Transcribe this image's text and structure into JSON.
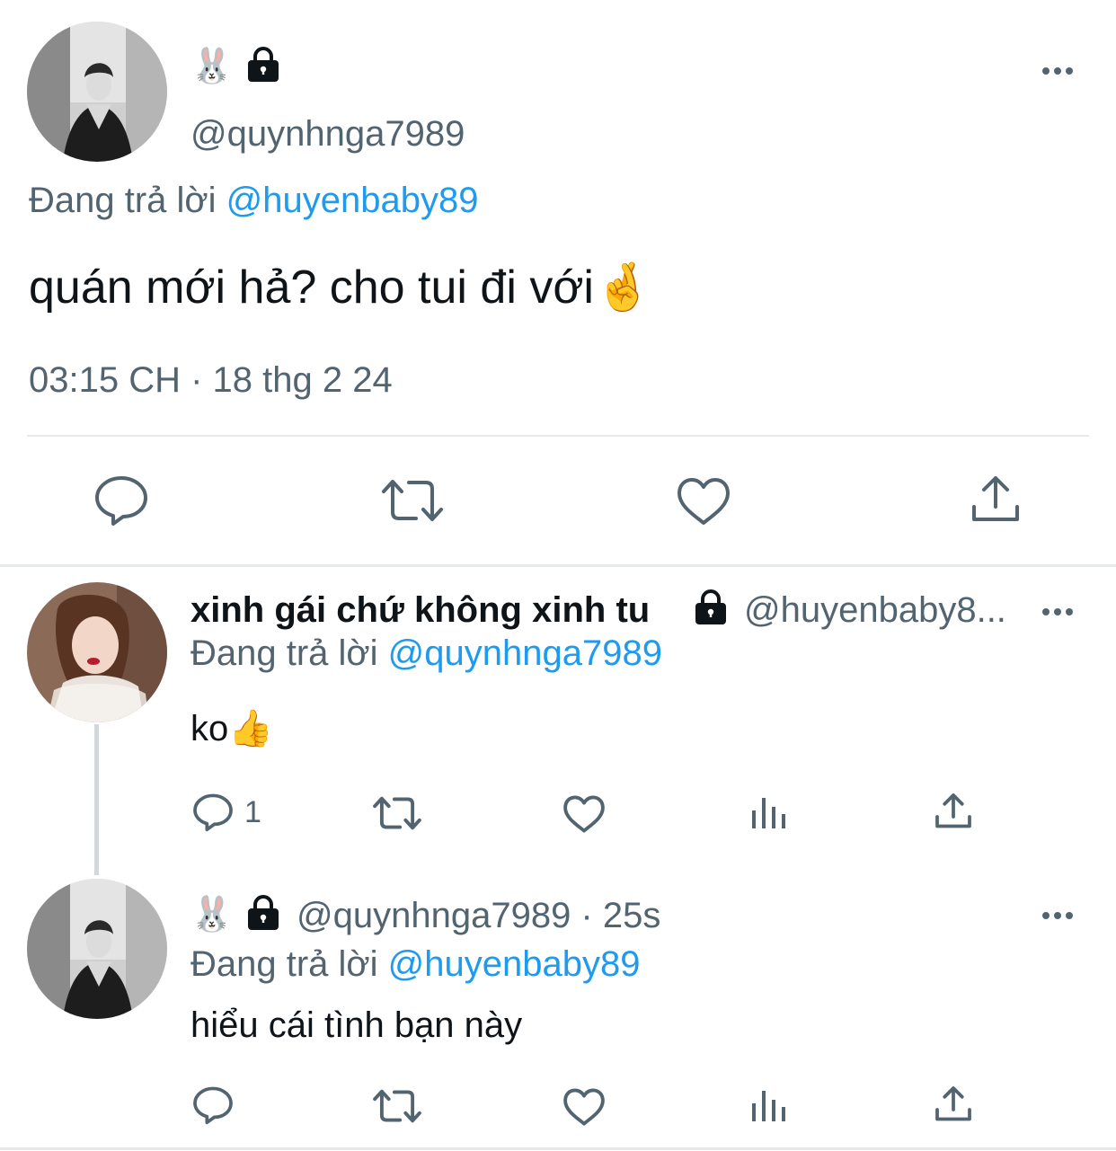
{
  "main_tweet": {
    "name_emoji": "🐰",
    "handle": "@quynhnga7989",
    "reply_prefix": "Đang trả lời",
    "reply_to": "@huyenbaby89",
    "text": "quán mới hả? cho tui đi với🤞",
    "timestamp": "03:15 CH · 18 thg 2 24"
  },
  "reply1": {
    "display_name": "xinh gái chứ không xinh tu",
    "handle": "@huyenbaby8...",
    "reply_prefix": "Đang trả lời",
    "reply_to": "@quynhnga7989",
    "text": "ko👍",
    "reply_count": "1"
  },
  "reply2": {
    "name_emoji": "🐰",
    "handle_time": "@quynhnga7989 · 25s",
    "reply_prefix": "Đang trả lời",
    "reply_to": "@huyenbaby89",
    "text": "hiểu cái tình bạn này"
  },
  "icons": {
    "lock": "lock-icon",
    "more": "more-icon",
    "reply": "reply-icon",
    "retweet": "retweet-icon",
    "like": "like-icon",
    "views": "views-icon",
    "share": "share-icon"
  },
  "colors": {
    "text": "#0f1419",
    "muted": "#536471",
    "link": "#1d9bf0",
    "divider": "#e6e9ec"
  }
}
